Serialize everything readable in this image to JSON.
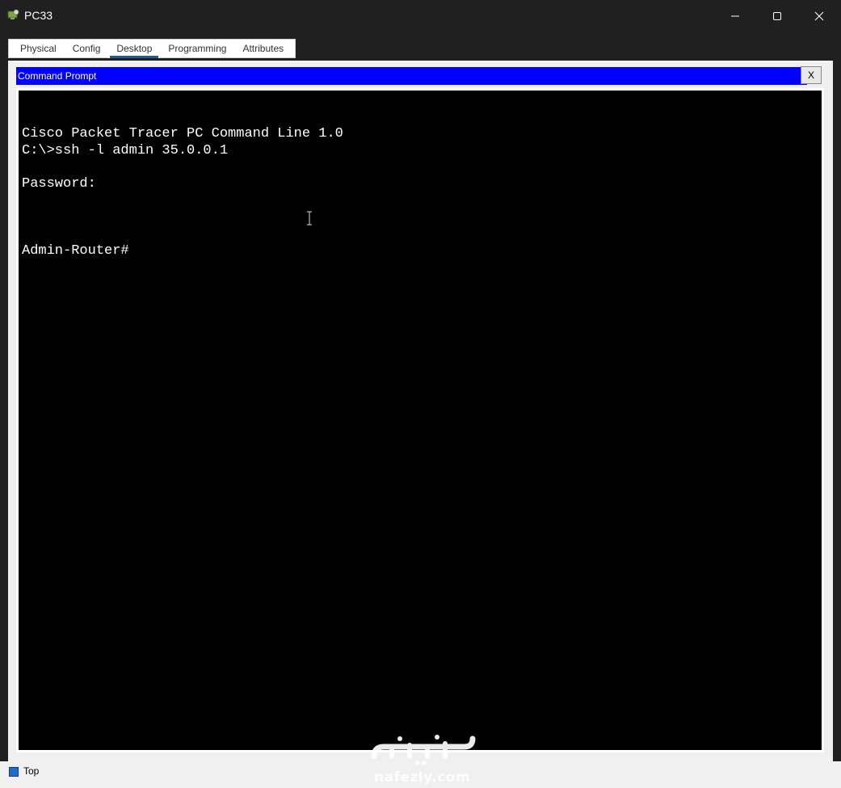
{
  "window": {
    "title": "PC33",
    "icon": "packet-tracer-pc-icon"
  },
  "tabs": [
    {
      "label": "Physical",
      "active": false
    },
    {
      "label": "Config",
      "active": false
    },
    {
      "label": "Desktop",
      "active": true
    },
    {
      "label": "Programming",
      "active": false
    },
    {
      "label": "Attributes",
      "active": false
    }
  ],
  "command_prompt": {
    "title": "Command Prompt",
    "close_label": "X",
    "header_color": "#0000ff",
    "lines": [
      "",
      "Cisco Packet Tracer PC Command Line 1.0",
      "C:\\>ssh -l admin 35.0.0.1",
      "",
      "Password:",
      "",
      "",
      "",
      "Admin-Router#"
    ]
  },
  "statusbar": {
    "top_checkbox_label": "Top",
    "top_checked": true
  },
  "watermark": {
    "site": "nafezly.com"
  }
}
